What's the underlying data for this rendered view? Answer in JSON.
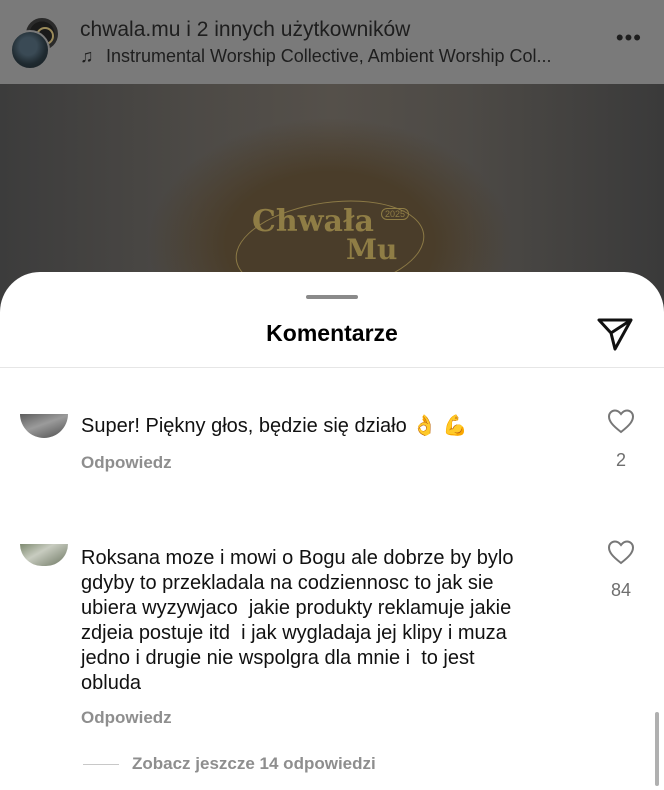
{
  "post_header": {
    "title": "chwala.mu i 2 innych użytkowników",
    "audio": "Instrumental Worship Collective, Ambient Worship Col...",
    "more_icon": "more-horizontal-icon"
  },
  "video": {
    "logo_line1": "Chwała",
    "logo_line2": "Mu",
    "year": "2025"
  },
  "sheet": {
    "title": "Komentarze",
    "send_icon": "send-icon"
  },
  "comments": [
    {
      "text": "Super! Piękny głos, będzie się działo",
      "emoji": "👌 💪",
      "reply_label": "Odpowiedz",
      "likes": "2"
    },
    {
      "lines": [
        "Roksana moze i mowi o Bogu ale dobrze by bylo",
        "gdyby to przekladala na codziennosc to jak sie",
        "ubiera wyzywjaco  jakie produkty reklamuje jakie",
        "zdjeia postuje itd  i jak wygladaja jej klipy i muza",
        "jedno i drugie nie wspolgra dla mnie i  to jest",
        "obluda"
      ],
      "reply_label": "Odpowiedz",
      "likes": "84",
      "more_replies": "Zobacz jeszcze 14 odpowiedzi"
    }
  ],
  "colors": {
    "overlay": "#7a7a7a",
    "sheet_bg": "#ffffff",
    "secondary_text": "#8e8e8e"
  }
}
